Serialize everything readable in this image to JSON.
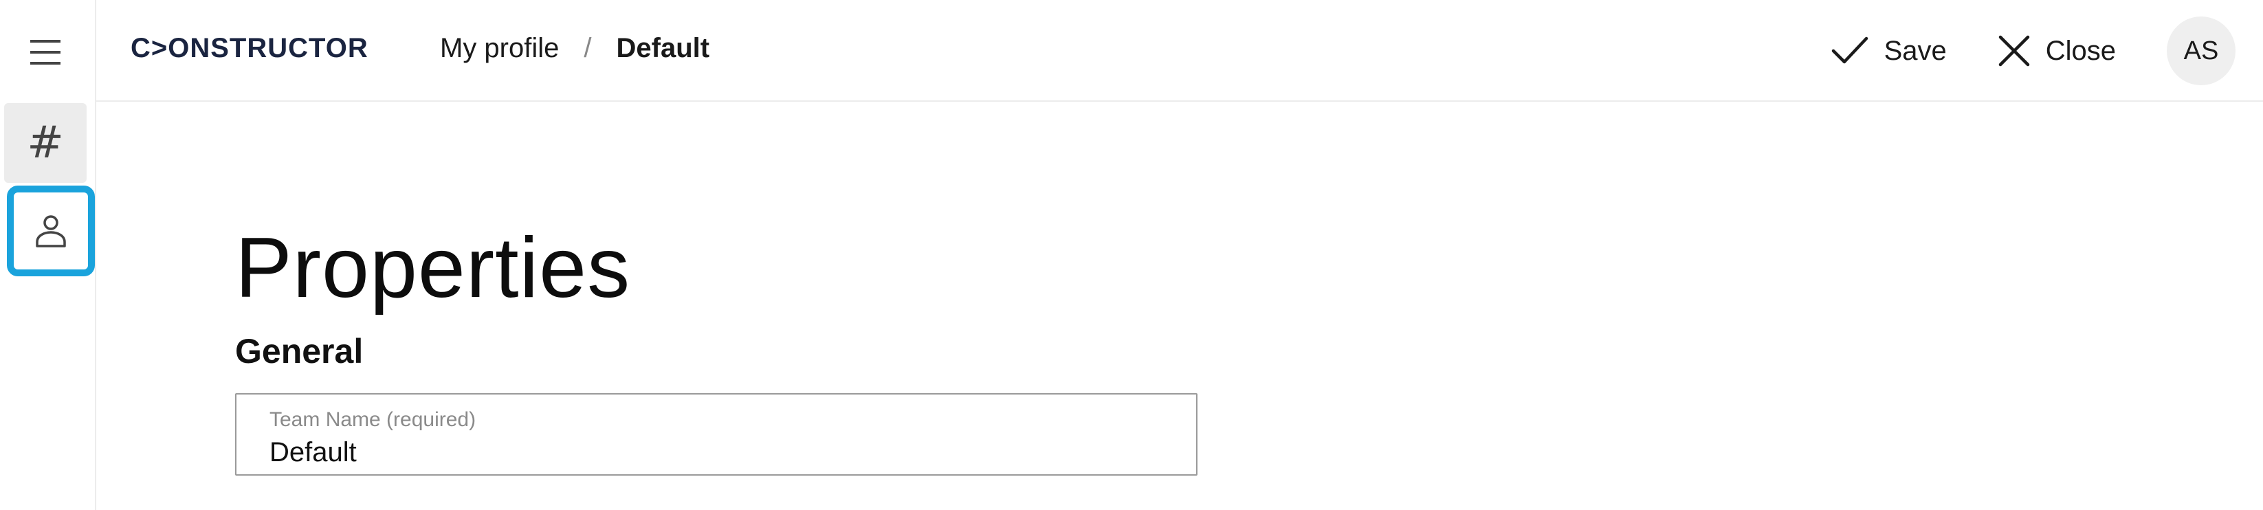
{
  "app": {
    "logo": "C>ONSTRUCTOR"
  },
  "rail": {
    "menu_icon": "hamburger-icon",
    "items": [
      {
        "name": "hash",
        "glyph": "#",
        "icon": "hash-icon"
      },
      {
        "name": "profile",
        "icon": "person-icon"
      }
    ]
  },
  "breadcrumb": {
    "items": [
      "My profile",
      "Default"
    ],
    "separator": "/"
  },
  "header": {
    "save_label": "Save",
    "close_label": "Close",
    "avatar_initials": "AS"
  },
  "page": {
    "title": "Properties",
    "section": "General"
  },
  "form": {
    "team_name": {
      "label": "Team Name (required)",
      "value": "Default"
    }
  },
  "colors": {
    "accent_highlight": "#1aa3dc",
    "logo": "#1a2440"
  }
}
